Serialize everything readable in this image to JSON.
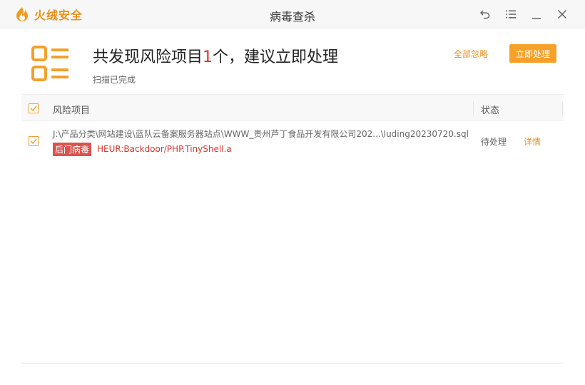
{
  "app": {
    "name": "火绒安全",
    "window_title": "病毒查杀",
    "brand_color": "#e8901a"
  },
  "window_controls": {
    "back_icon": "undo-arrow-icon",
    "menu_icon": "menu-lines-icon",
    "minimize_icon": "minimize-icon",
    "close_icon": "close-icon"
  },
  "summary": {
    "headline_prefix": "共发现风险项目",
    "count": "1",
    "headline_suffix": "个，建议立即处理",
    "status_text": "扫描已完成",
    "ignore_all_label": "全部忽略",
    "process_now_label": "立即处理"
  },
  "table": {
    "header_item": "风险项目",
    "header_status": "状态",
    "rows": [
      {
        "checked": true,
        "path": "J:\\产品分类\\网站建设\\蓝队云备案服务器站点\\WWW_贵州芦丁食品开发有限公司202...\\luding20230720.sql",
        "tag": "后门病毒",
        "virus_name": "HEUR:Backdoor/PHP.TinyShell.a",
        "status": "待处理",
        "detail_label": "详情"
      }
    ]
  }
}
